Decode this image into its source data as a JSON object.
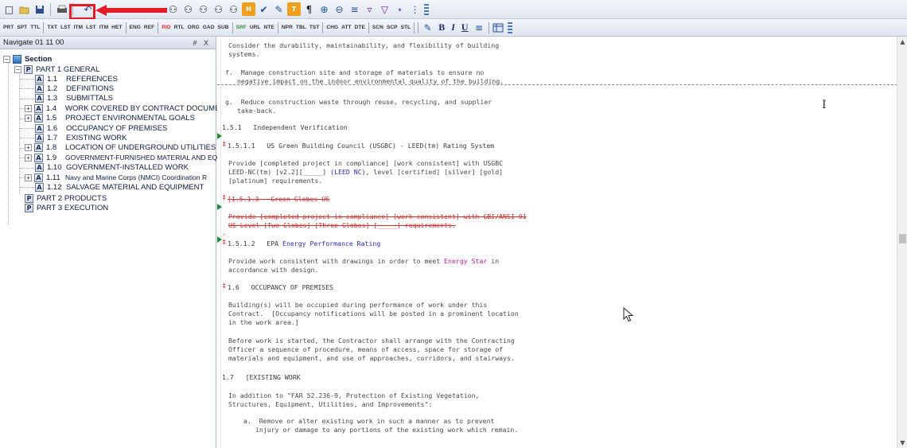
{
  "toolbar1": {
    "icons": [
      "new-file-icon",
      "open-folder-icon",
      "save-icon",
      "print-icon",
      "undo-icon",
      "find-icon",
      "find-prev-icon",
      "find-all-icon",
      "find-next-icon",
      "replace-icon",
      "highlight-icon",
      "spell-check-icon",
      "format-icon",
      "paragraph-icon",
      "zoom-in-icon",
      "zoom-out-icon",
      "align-icon",
      "filter-icon",
      "funnel-icon",
      "pin-icon",
      "more-icon"
    ]
  },
  "toolbar2": {
    "tags": [
      "PRT",
      "SPT",
      "TTL",
      "TXT",
      "LST",
      "ITM",
      "LST",
      "ITM",
      "HET",
      "ENG",
      "REF",
      "RID",
      "RTL",
      "ORG",
      "GAD",
      "SUB",
      "SRF",
      "URL",
      "NTE",
      "NPR",
      "TBL",
      "TST",
      "CHG",
      "ATT",
      "DTE",
      "SCN",
      "SCP",
      "STL"
    ],
    "format_bold": "B",
    "format_italic": "I",
    "format_underline": "U"
  },
  "navigator": {
    "title": "Navigate 01 11 00",
    "controls": "# X",
    "root": "Section",
    "part1": "PART 1  GENERAL",
    "items": [
      {
        "num": "1.1",
        "label": "REFERENCES"
      },
      {
        "num": "1.2",
        "label": "DEFINITIONS"
      },
      {
        "num": "1.3",
        "label": "SUBMITTALS"
      },
      {
        "num": "1.4",
        "label": "WORK COVERED BY CONTRACT DOCUMENTS"
      },
      {
        "num": "1.5",
        "label": "PROJECT ENVIRONMENTAL GOALS"
      },
      {
        "num": "1.6",
        "label": "OCCUPANCY OF PREMISES"
      },
      {
        "num": "1.7",
        "label": "EXISTING WORK"
      },
      {
        "num": "1.8",
        "label": "LOCATION OF UNDERGROUND UTILITIES"
      },
      {
        "num": "1.9",
        "label": "GOVERNMENT-FURNISHED MATERIAL AND EQI"
      },
      {
        "num": "1.10",
        "label": "GOVERNMENT-INSTALLED WORK"
      },
      {
        "num": "1.11",
        "label": "Navy and Marine Corps (NMCI) Coordination R"
      },
      {
        "num": "1.12",
        "label": "SALVAGE MATERIAL AND EQUIPMENT"
      }
    ],
    "part2": "PART 2  PRODUCTS",
    "part3": "PART 3  EXECUTION"
  },
  "document": {
    "l01": "Consider the durability, maintainability, and flexibility of building",
    "l02": "systems.",
    "l03": "f.  Manage construction site and storage of materials to ensure no",
    "l04": "negative impact on the indoor environmental quality of the building.",
    "l05": "g.  Reduce construction waste through reuse, recycling, and supplier",
    "l06": "take-back.",
    "h151": "1.5.1   Independent Verification",
    "h1511": "1.5.1.1   US Green Building Council (USGBC) - LEED(tm) Rating System",
    "p1a": "Provide [completed project in compliance] [work consistent] with USGBC",
    "p1b_a": "LEED-NC(tm) [v2.2][_____] ",
    "p1b_b": "(LEED NC)",
    "p1b_c": ", level [certified] [silver] [gold]",
    "p1c": "[platinum] requirements.",
    "h1513": "[1.5.1.3   Green Globes US",
    "p2a": "Provide [completed project in compliance] [work consistent] with GBI/ANSI 01",
    "p2b": "US Level [Two Globes] [Three Globes] [_____] requirements.",
    "h1512_a": "1.5.1.2   EPA ",
    "h1512_b": "Energy Performance Rating",
    "p3a_a": "Provide work consistent with drawings in order to meet ",
    "p3a_b": "Energy Star",
    "p3a_c": " in",
    "p3b": "accordance with design.",
    "h16": "1.6   OCCUPANCY OF PREMISES",
    "p4a": "Building(s) will be occupied during performance of work under this",
    "p4b": "Contract.  [Occupancy notifications will be posted in a prominent location",
    "p4c": "in the work area.]",
    "p5a": "Before work is started, the Contractor shall arrange with the Contracting",
    "p5b": "Officer a sequence of procedure, means of access, space for storage of",
    "p5c": "materials and equipment, and use of approaches, corridors, and stairways.",
    "h17": "1.7   [EXISTING WORK",
    "p6a": "In addition to \"FAR 52.236-9, Protection of Existing Vegetation,",
    "p6b": "Structures, Equipment, Utilities, and Improvements\":",
    "p7a": "a.  Remove or alter existing work in such a manner as to prevent",
    "p7b": "injury or damage to any portions of the existing work which remain."
  },
  "colors": {
    "highlight": "#e51c23",
    "markup": "#d32f2f",
    "link_blue": "#2a2ab8",
    "pink": "#c2189b",
    "marker_green": "#1d8f3a"
  }
}
